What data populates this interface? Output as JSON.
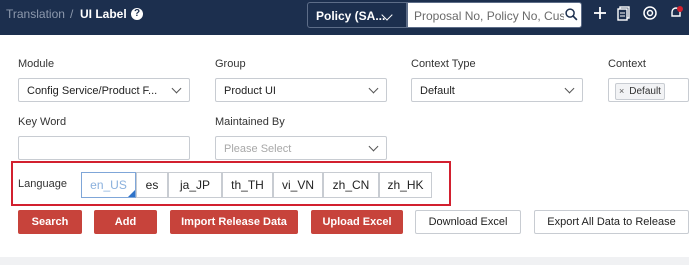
{
  "header": {
    "breadcrumb_parent": "Translation",
    "breadcrumb_sep": "/",
    "breadcrumb_current": "UI Label",
    "help_glyph": "?",
    "policy_select": "Policy (SA...",
    "search_placeholder": "Proposal No, Policy No, Cust",
    "bg_color": "#1c2f4e"
  },
  "form": {
    "module": {
      "label": "Module",
      "value": "Config Service/Product F..."
    },
    "group": {
      "label": "Group",
      "value": "Product UI"
    },
    "context_type": {
      "label": "Context Type",
      "value": "Default"
    },
    "context": {
      "label": "Context",
      "tag": "Default",
      "tag_close": "×"
    },
    "keyword": {
      "label": "Key Word",
      "value": ""
    },
    "maintained_by": {
      "label": "Maintained By",
      "placeholder": "Please Select"
    }
  },
  "language": {
    "label": "Language",
    "tabs": [
      "en_US",
      "es",
      "ja_JP",
      "th_TH",
      "vi_VN",
      "zh_CN",
      "zh_HK"
    ],
    "active": "en_US"
  },
  "actions": {
    "search": "Search",
    "add": "Add",
    "import": "Import Release Data",
    "upload": "Upload Excel",
    "download": "Download Excel",
    "export": "Export All Data to Release"
  },
  "colors": {
    "primary_red": "#c7433b",
    "highlight_frame": "#d2202f",
    "active_tab": "#8ab0dd"
  }
}
